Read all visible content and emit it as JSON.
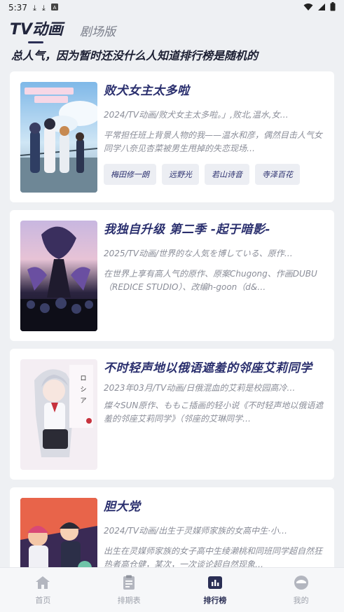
{
  "status_bar": {
    "time": "5:37",
    "icons": [
      "download-icon",
      "download-icon",
      "font-icon",
      "wifi-icon",
      "signal-icon",
      "battery-icon"
    ]
  },
  "tabs": [
    {
      "label": "TV动画",
      "active": true
    },
    {
      "label": "剧场版",
      "active": false
    }
  ],
  "notice": "总人气，因为暂时还没什么人知道排行榜是随机的",
  "cards": [
    {
      "title": "败犬女主太多啦",
      "meta": "2024/TV动画/败犬女主太多啦。」,败北,温水,女…",
      "desc": "平常担任班上背景人物的我——温水和彦，偶然目击人气女同学八奈见杏菜被男生甩掉的失恋现场…",
      "chips": [
        "梅田修一朗",
        "远野光",
        "若山诗音",
        "寺泽百花"
      ]
    },
    {
      "title": "我独自升级 第二季 -起于暗影-",
      "meta": "2025/TV动画/世界的な人気を博している、原作…",
      "desc": "在世界上享有高人气的原作、原案Chugong、作画DUBU（REDICE STUDIO）、改编h-goon（d&…",
      "chips": []
    },
    {
      "title": "不时轻声地以俄语遮羞的邻座艾莉同学",
      "meta": "2023年03月/TV动画/日俄混血的艾莉是校园高冷…",
      "desc": "燦々SUN原作、ももこ插画的轻小说《不时轻声地以俄语遮羞的邻座艾莉同学》（邻座的艾琳同学…",
      "chips": []
    },
    {
      "title": "胆大党",
      "meta": "2024/TV动画/出生于灵媒师家族的女高中生·小…",
      "desc": "出生在灵媒师家族的女子高中生绫濑桃和同班同学超自然狂热者高仓健，某次，一次谈论超自然现象…",
      "chips": []
    }
  ],
  "bottom_nav": [
    {
      "label": "首页",
      "icon": "home-icon",
      "active": false
    },
    {
      "label": "排期表",
      "icon": "schedule-icon",
      "active": false
    },
    {
      "label": "排行榜",
      "icon": "ranking-icon",
      "active": true
    },
    {
      "label": "我的",
      "icon": "profile-icon",
      "active": false
    }
  ],
  "colors": {
    "accent": "#2b2f55",
    "title": "#2a2f6e",
    "background": "#eef0f3",
    "muted": "#8a8d98"
  }
}
